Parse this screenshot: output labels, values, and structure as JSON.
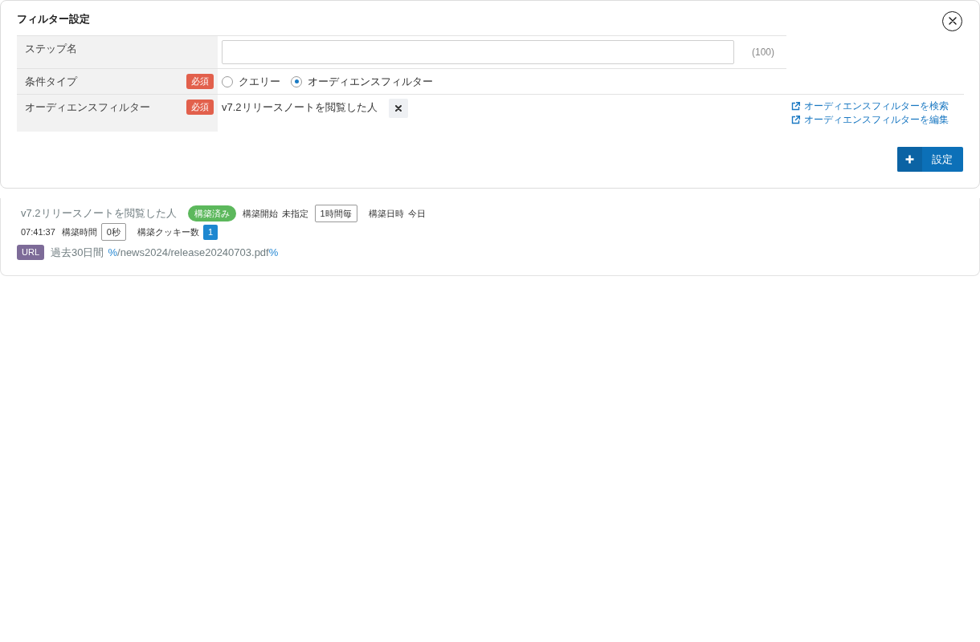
{
  "dialog": {
    "title": "フィルター設定",
    "form_rows": [
      {
        "kind": "text_input",
        "label": "ステップ名",
        "counter": "(100)"
      },
      {
        "kind": "radio",
        "label": "条件タイプ",
        "required_badge": "必須",
        "options": [
          {
            "label": "クエリー",
            "selected": false
          },
          {
            "label": "オーディエンスフィルター",
            "selected": true
          }
        ]
      },
      {
        "kind": "selection",
        "label": "オーディエンスフィルター",
        "required_badge": "必須",
        "value": "v7.2リリースノートを閲覧した人",
        "links": [
          "オーディエンスフィルターを検索",
          "オーディエンスフィルターを編集"
        ]
      }
    ],
    "submit_button": "設定"
  },
  "summary": {
    "title": "v7.2リリースノートを閲覧した人",
    "detail_lines": [
      {
        "items": [
          {
            "kind": "status",
            "text": "構築済み"
          },
          {
            "kind": "label",
            "text": "構築開始"
          },
          {
            "kind": "value",
            "text": "未指定"
          },
          {
            "kind": "tag",
            "text": "1時間毎"
          },
          {
            "kind": "label",
            "text": "構築日時"
          },
          {
            "kind": "value",
            "text": "今日"
          }
        ]
      },
      {
        "items": [
          {
            "kind": "value",
            "text": "07:41:37"
          },
          {
            "kind": "label",
            "text": "構築時間"
          },
          {
            "kind": "tag",
            "text": "0秒"
          },
          {
            "kind": "label",
            "text": "構築クッキー数"
          },
          {
            "kind": "count",
            "text": "1"
          }
        ]
      }
    ],
    "condition": {
      "type": "URL",
      "period": "過去30日間",
      "pattern": [
        {
          "kind": "wildcard",
          "text": "%"
        },
        {
          "kind": "literal",
          "text": "/news2024/release20240703.pdf"
        },
        {
          "kind": "wildcard",
          "text": "%"
        }
      ]
    }
  }
}
